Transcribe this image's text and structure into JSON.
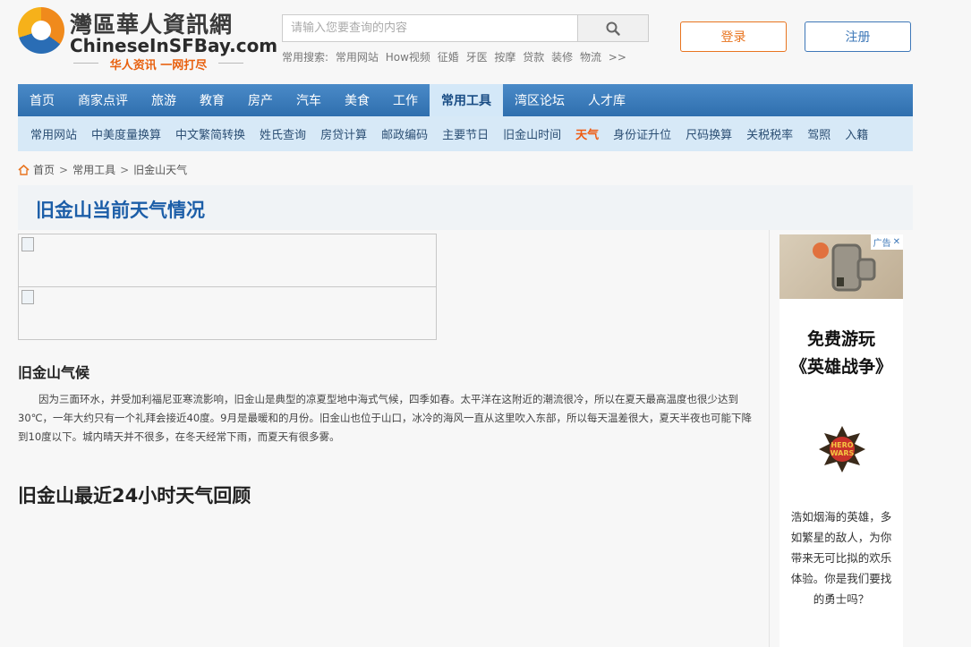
{
  "header": {
    "logo_cn": "灣區華人資訊網",
    "logo_en": "ChineseInSFBay.com",
    "logo_slogan": "华人资讯  一网打尽",
    "search_placeholder": "请输入您要查询的内容",
    "hot_label": "常用搜索:",
    "hot_links": [
      "常用网站",
      "How视频",
      "征婚",
      "牙医",
      "按摩",
      "贷款",
      "装修",
      "物流",
      ">>"
    ],
    "login_label": "登录",
    "register_label": "注册"
  },
  "main_nav": [
    {
      "label": "首页",
      "active": false
    },
    {
      "label": "商家点评",
      "active": false
    },
    {
      "label": "旅游",
      "active": false
    },
    {
      "label": "教育",
      "active": false
    },
    {
      "label": "房产",
      "active": false
    },
    {
      "label": "汽车",
      "active": false
    },
    {
      "label": "美食",
      "active": false
    },
    {
      "label": "工作",
      "active": false
    },
    {
      "label": "常用工具",
      "active": true
    },
    {
      "label": "湾区论坛",
      "active": false
    },
    {
      "label": "人才库",
      "active": false
    }
  ],
  "sub_nav": [
    {
      "label": "常用网站",
      "current": false
    },
    {
      "label": "中美度量换算",
      "current": false
    },
    {
      "label": "中文繁简转换",
      "current": false
    },
    {
      "label": "姓氏查询",
      "current": false
    },
    {
      "label": "房贷计算",
      "current": false
    },
    {
      "label": "邮政编码",
      "current": false
    },
    {
      "label": "主要节日",
      "current": false
    },
    {
      "label": "旧金山时间",
      "current": false
    },
    {
      "label": "天气",
      "current": true
    },
    {
      "label": "身份证升位",
      "current": false
    },
    {
      "label": "尺码换算",
      "current": false
    },
    {
      "label": "关税税率",
      "current": false
    },
    {
      "label": "驾照",
      "current": false
    },
    {
      "label": "入籍",
      "current": false
    }
  ],
  "breadcrumb": [
    "首页",
    "常用工具",
    "旧金山天气"
  ],
  "page_title": "旧金山当前天气情况",
  "climate": {
    "heading": "旧金山气候",
    "text": "因为三面环水，并受加利福尼亚寒流影响，旧金山是典型的凉夏型地中海式气候，四季如春。太平洋在这附近的潮流很冷，所以在夏天最高温度也很少达到30℃，一年大约只有一个礼拜会接近40度。9月是最暖和的月份。旧金山也位于山口，冰冷的海风一直从这里吹入东部，所以每天温差很大，夏天半夜也可能下降到10度以下。城内晴天并不很多，在冬天经常下雨，而夏天有很多雾。"
  },
  "history_heading": "旧金山最近24小时天气回顾",
  "ad": {
    "tag": "广告",
    "title_line1": "免费游玩",
    "title_line2": "《英雄战争》",
    "logo_text": "HERO WARS",
    "desc": "浩如烟海的英雄，多如繁星的敌人，为你带来无可比拟的欢乐体验。你是我们要找的勇士吗？"
  },
  "colors": {
    "nav_blue": "#3a7cbd",
    "accent_orange": "#ef5b12",
    "title_blue": "#1c5ea8"
  }
}
